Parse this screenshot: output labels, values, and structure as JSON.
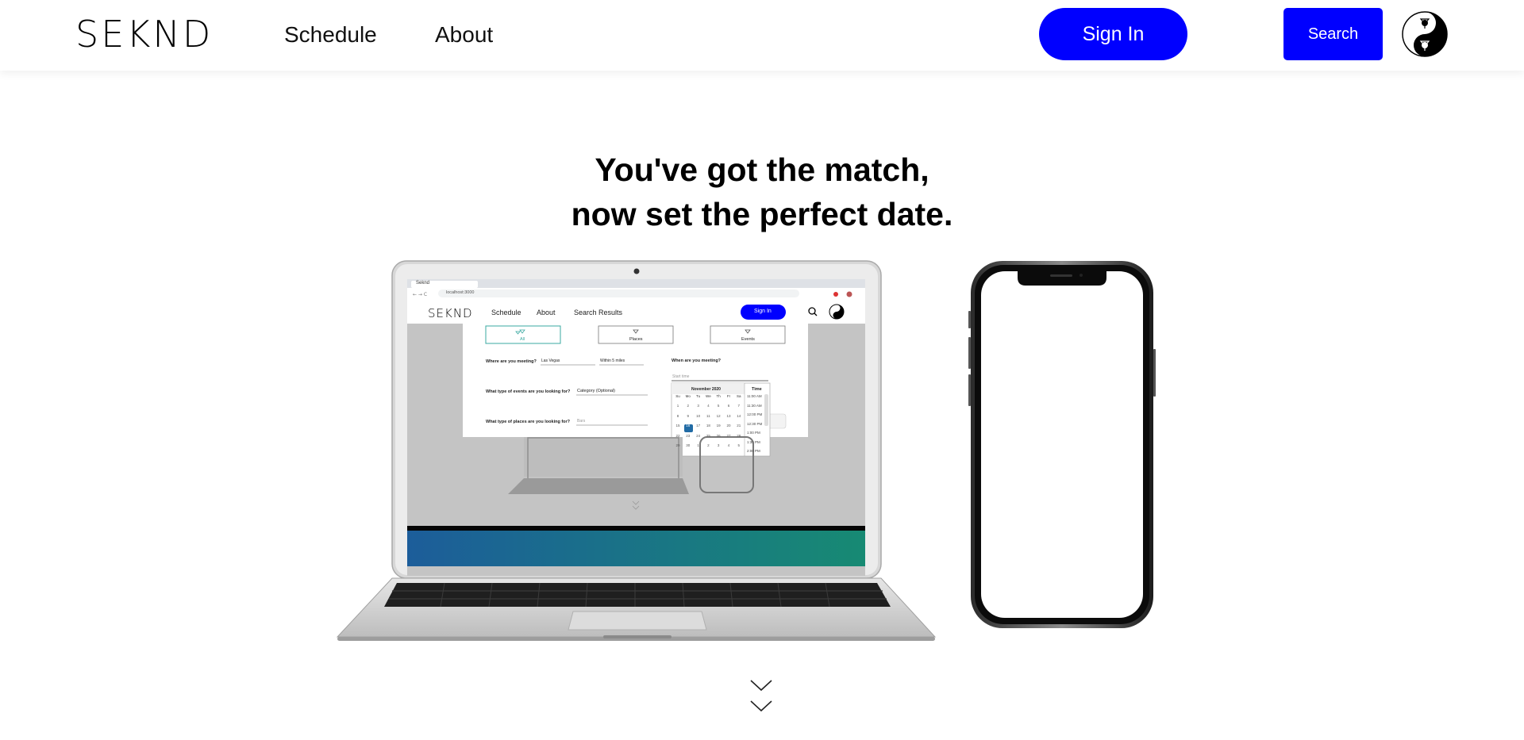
{
  "header": {
    "logo": "SEKND",
    "nav": {
      "schedule": "Schedule",
      "about": "About"
    },
    "signin_label": "Sign In",
    "search_label": "Search"
  },
  "hero": {
    "line1": "You've got the match,",
    "line2": "now set the perfect date."
  },
  "laptop_screen": {
    "browser": {
      "tab_title": "Seknd",
      "url": "localhost:3000"
    },
    "nav": {
      "logo": "SEKND",
      "schedule": "Schedule",
      "about": "About",
      "search_results": "Search Results",
      "signin": "Sign In"
    },
    "categories": {
      "all": "All",
      "places": "Places",
      "events": "Events"
    },
    "form": {
      "where_label": "Where are you meeting?",
      "where_value": "Las Vegas",
      "distance_value": "Within 5 miles",
      "when_label": "When are you meeting?",
      "start_time_placeholder": "Start time",
      "events_label": "What type of events are you looking for?",
      "category_value": "Category (Optional)",
      "places_label": "What type of places are you looking for?",
      "places_placeholder": "Bars"
    },
    "calendar": {
      "month": "November 2020",
      "time_header": "Time",
      "weekdays": [
        "Su",
        "Mo",
        "Tu",
        "We",
        "Th",
        "Fr",
        "Sa"
      ],
      "weeks": [
        [
          "1",
          "2",
          "3",
          "4",
          "5",
          "6",
          "7"
        ],
        [
          "8",
          "9",
          "10",
          "11",
          "12",
          "13",
          "14"
        ],
        [
          "15",
          "16",
          "17",
          "18",
          "19",
          "20",
          "21"
        ],
        [
          "22",
          "23",
          "24",
          "25",
          "26",
          "27",
          "28"
        ],
        [
          "29",
          "30",
          "1",
          "2",
          "3",
          "4",
          "5"
        ]
      ],
      "selected_day": "16",
      "times": [
        "11:00 AM",
        "11:30 AM",
        "12:00 PM",
        "12:30 PM",
        "1:00 PM",
        "1:30 PM",
        "2:00 PM"
      ]
    }
  },
  "colors": {
    "accent_blue": "#0000ff",
    "selected_day": "#216ba5",
    "gradient_start": "#1c5d9a",
    "gradient_end": "#178a73"
  }
}
